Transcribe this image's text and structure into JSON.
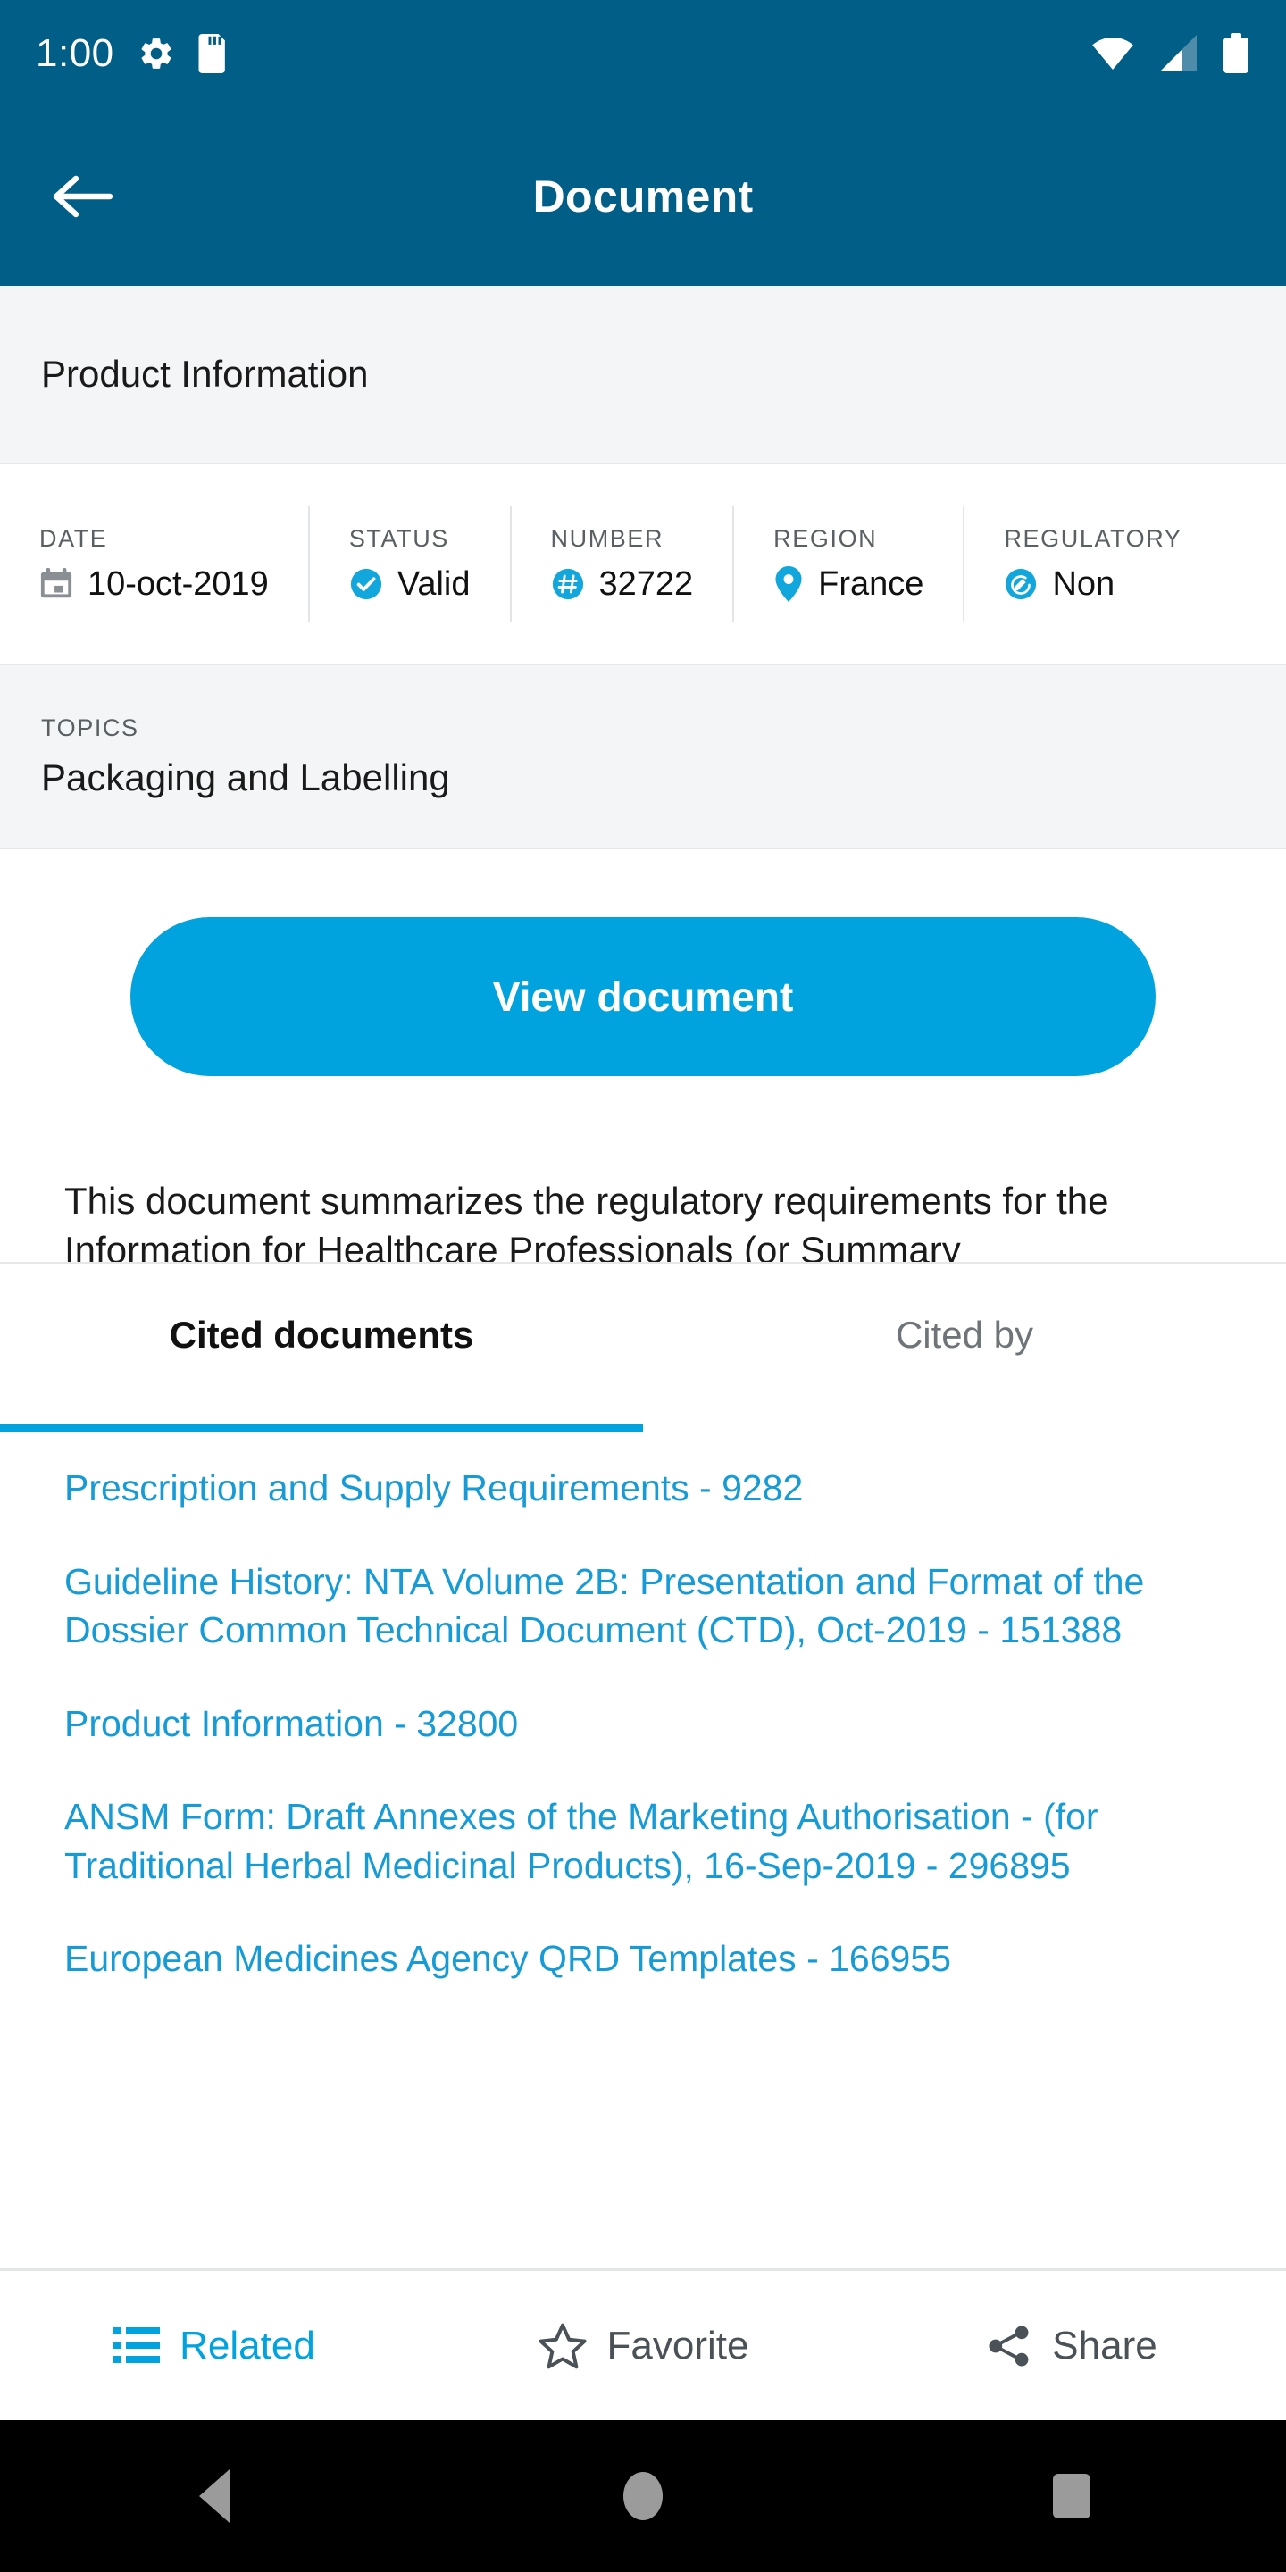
{
  "statusbar": {
    "time": "1:00",
    "left_icons": [
      "gear-icon",
      "sd-card-icon"
    ],
    "right_icons": [
      "wifi-icon",
      "cellular-signal-icon",
      "battery-icon"
    ]
  },
  "appbar": {
    "back_label": "back-arrow",
    "title": "Document"
  },
  "subtitle": {
    "text": "Product Information"
  },
  "meta": {
    "cells": [
      {
        "label": "DATE",
        "value": "10-oct-2019",
        "icon": "calendar-icon"
      },
      {
        "label": "STATUS",
        "value": "Valid",
        "icon": "check-circle-icon"
      },
      {
        "label": "NUMBER",
        "value": "32722",
        "icon": "hash-circle-icon"
      },
      {
        "label": "REGION",
        "value": "France",
        "icon": "location-pin-icon"
      },
      {
        "label": "REGULATORY",
        "value": "Non",
        "icon": "edit-circle-icon"
      }
    ]
  },
  "topics": {
    "label": "TOPICS",
    "value": "Packaging and Labelling"
  },
  "cta": {
    "label": "View document"
  },
  "description": {
    "text": "This document summarizes the regulatory requirements for the Information for Healthcare Professionals (or Summary"
  },
  "tabs": {
    "active": "Cited documents",
    "inactive": "Cited by"
  },
  "cited_documents": [
    "Prescription and Supply Requirements - 9282",
    "Guideline History: NTA Volume 2B: Presentation and Format of the Dossier Common Technical Document (CTD), Oct-2019 - 151388",
    "Product Information - 32800",
    "ANSM Form: Draft Annexes of the Marketing Authorisation - (for Traditional Herbal Medicinal Products), 16-Sep-2019 - 296895",
    "European Medicines Agency QRD Templates - 166955"
  ],
  "actions": [
    {
      "label": "Related",
      "icon": "list-icon"
    },
    {
      "label": "Favorite",
      "icon": "star-outline-icon"
    },
    {
      "label": "Share",
      "icon": "share-icon"
    }
  ],
  "navbar": {
    "back": "nav-back-triangle",
    "home": "nav-home-circle",
    "recents": "nav-recents-square"
  },
  "colors": {
    "appbar": "#015E87",
    "accent": "#00A3DE",
    "link": "#179BD7",
    "band": "#F4F5F7"
  }
}
